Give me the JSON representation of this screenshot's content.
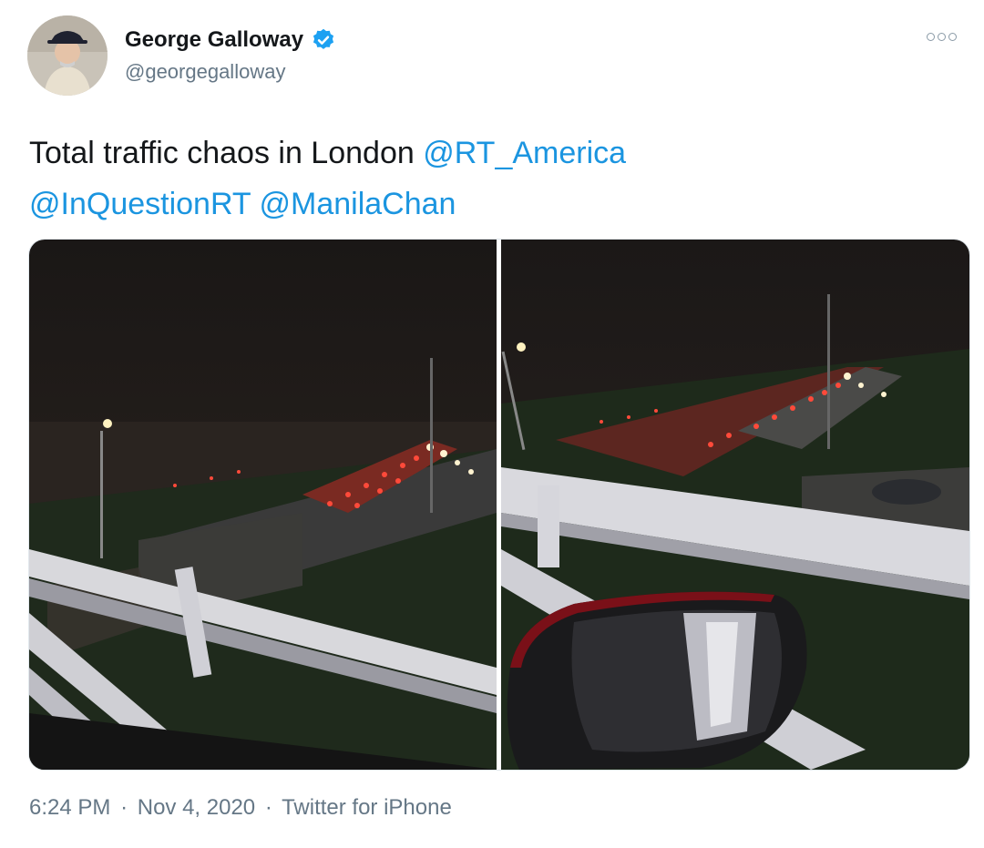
{
  "author": {
    "name": "George Galloway",
    "handle": "@georgegalloway",
    "verified_icon": "verified-badge-icon",
    "avatar_icon": "avatar"
  },
  "tweet": {
    "text_prefix": "Total traffic chaos in London ",
    "mentions": [
      "@RT_America",
      "@InQuestionRT",
      "@ManilaChan"
    ]
  },
  "meta": {
    "time": "6:24 PM",
    "separator": "·",
    "date": "Nov 4, 2020",
    "source": "Twitter for iPhone"
  },
  "colors": {
    "link": "#1b95e0",
    "secondary": "#657786",
    "verified": "#1da1f2"
  }
}
